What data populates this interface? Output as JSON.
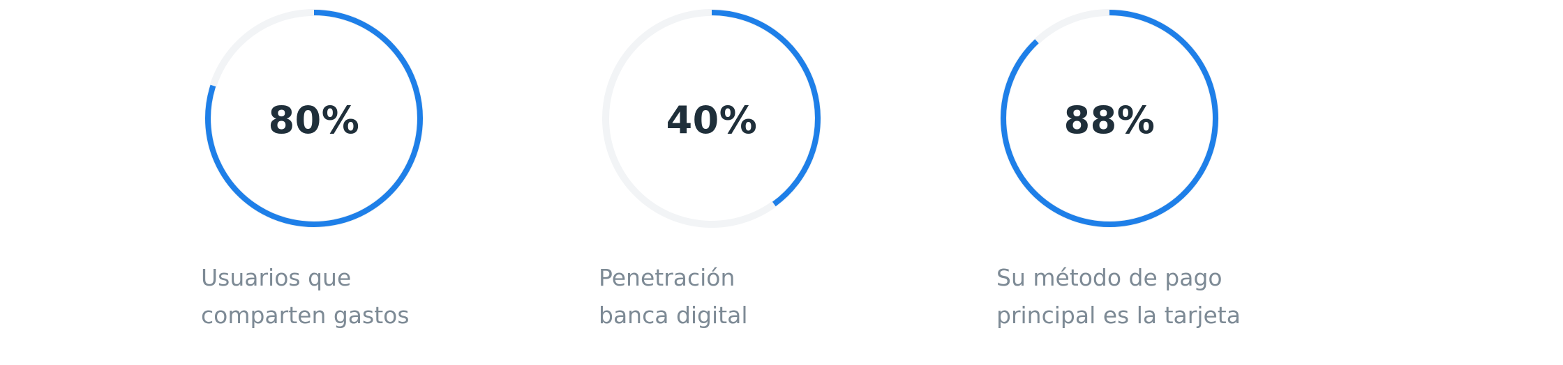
{
  "colors": {
    "arc": "#1e7fe8",
    "value_text": "#1f2f3a",
    "label_text": "#7d8a95"
  },
  "chart_data": [
    {
      "type": "pie",
      "values": [
        80
      ],
      "value_label": "80%",
      "label_lines": [
        "Usuarios que",
        "comparten gastos"
      ]
    },
    {
      "type": "pie",
      "values": [
        40
      ],
      "value_label": "40%",
      "label_lines": [
        "Penetración",
        "banca digital"
      ]
    },
    {
      "type": "pie",
      "values": [
        88
      ],
      "value_label": "88%",
      "label_lines": [
        "Su método de pago",
        "principal es la tarjeta"
      ]
    }
  ]
}
